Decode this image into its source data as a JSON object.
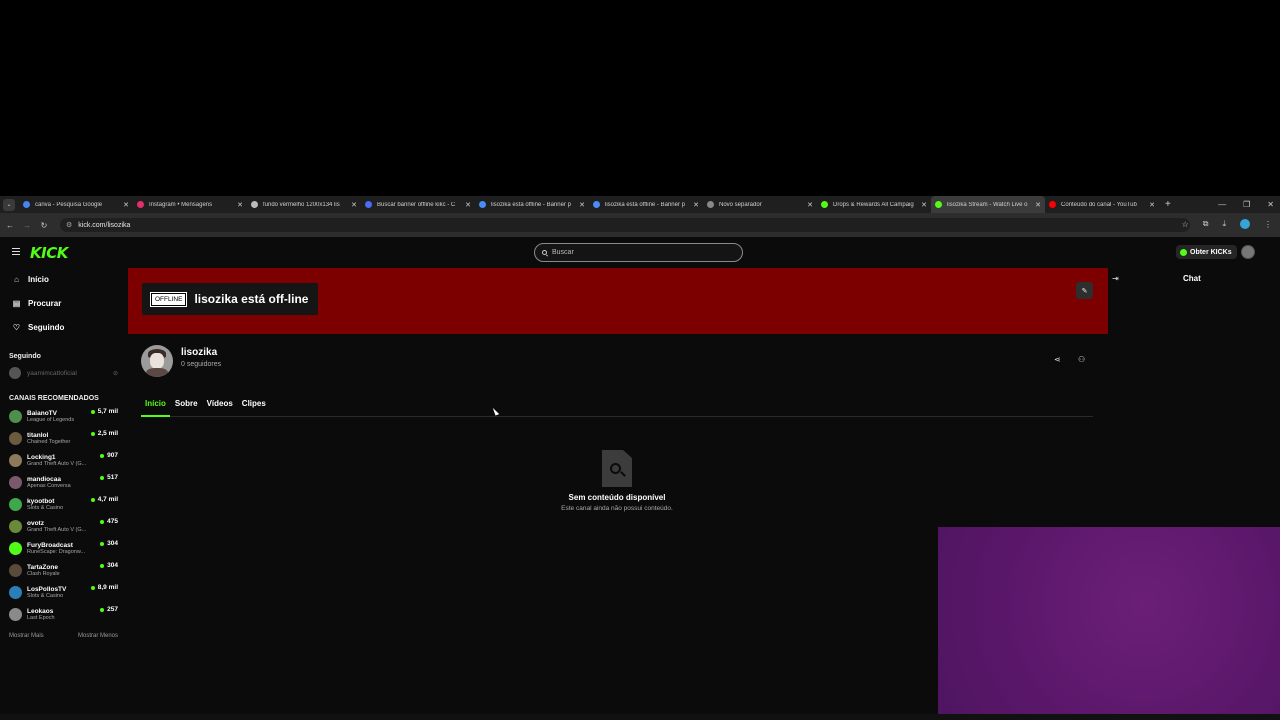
{
  "browser": {
    "tabs": [
      {
        "title": "canva - Pesquisa Google",
        "favicon_color": "#4285f4",
        "active": false
      },
      {
        "title": "Instagram • Mensagens",
        "favicon_color": "#e1306c",
        "active": false
      },
      {
        "title": "fundo vermelho 1200x134 lis",
        "favicon_color": "#bbbbbb",
        "active": false
      },
      {
        "title": "Buscar banner offline kikc - C",
        "favicon_color": "#4a6cf7",
        "active": false
      },
      {
        "title": "lisozika está offline - Banner p",
        "favicon_color": "#4a8cf7",
        "active": false
      },
      {
        "title": "lisozika está offline - Banner p",
        "favicon_color": "#4a8cf7",
        "active": false
      },
      {
        "title": "Novo separador",
        "favicon_color": "#888888",
        "active": false
      },
      {
        "title": "Drops & Rewards All Campaig",
        "favicon_color": "#53fc18",
        "active": false
      },
      {
        "title": "lisozika Stream - Watch Live o",
        "favicon_color": "#53fc18",
        "active": true
      },
      {
        "title": "Conteúdo do canal - YouTub",
        "favicon_color": "#ff0000",
        "active": false
      }
    ],
    "url": "kick.com/lisozika"
  },
  "kick": {
    "logo": "KICK",
    "search_placeholder": "Buscar",
    "get_kicks": "Obter KICKs",
    "sidebar": {
      "nav": [
        {
          "label": "Início",
          "icon": "home-icon"
        },
        {
          "label": "Procurar",
          "icon": "browse-icon"
        },
        {
          "label": "Seguindo",
          "icon": "heart-icon"
        }
      ],
      "following_header": "Seguindo",
      "following": [
        {
          "name": "yaamimcattoficial"
        }
      ],
      "recommended_header": "CANAIS RECOMENDADOS",
      "recommended": [
        {
          "name": "BaianoTV",
          "game": "League of Legends",
          "viewers": "5,7 mil",
          "color": "#4e8f4e"
        },
        {
          "name": "titanlol",
          "game": "Chained Together",
          "viewers": "2,5 mil",
          "color": "#6b5a3e"
        },
        {
          "name": "Locking1",
          "game": "Grand Theft Auto V (G...",
          "viewers": "907",
          "color": "#8d7a5b"
        },
        {
          "name": "mandiocaa",
          "game": "Apenas Conversa",
          "viewers": "517",
          "color": "#7a5a6a"
        },
        {
          "name": "kyootbot",
          "game": "Slots & Casino",
          "viewers": "4,7 mil",
          "color": "#3fa84a"
        },
        {
          "name": "ovotz",
          "game": "Grand Theft Auto V (G...",
          "viewers": "475",
          "color": "#6a8a3a"
        },
        {
          "name": "FuryBroadcast",
          "game": "RuneScape: Dragonw...",
          "viewers": "304",
          "color": "#53fc18"
        },
        {
          "name": "TartaZone",
          "game": "Clash Royale",
          "viewers": "304",
          "color": "#5a4a3a"
        },
        {
          "name": "LosPollosTV",
          "game": "Slots & Casino",
          "viewers": "8,9 mil",
          "color": "#2a7fb8"
        },
        {
          "name": "Leokaos",
          "game": "Last Epoch",
          "viewers": "257",
          "color": "#8a8a8a"
        }
      ],
      "show_more": "Mostrar Mais",
      "show_less": "Mostrar Menos"
    },
    "banner": {
      "badge": "OFFLINE",
      "title": "lisozika está off-line",
      "color": "#7d0000"
    },
    "channel": {
      "name": "lisozika",
      "followers": "0 seguidores"
    },
    "tabs": [
      "Início",
      "Sobre",
      "Vídeos",
      "Clipes"
    ],
    "empty": {
      "title": "Sem conteúdo disponível",
      "subtitle": "Este canal ainda não possui conteúdo."
    },
    "chat_title": "Chat"
  },
  "colors": {
    "accent": "#53fc18",
    "banner": "#7d0000",
    "overlay_purple": "#5a176a"
  }
}
